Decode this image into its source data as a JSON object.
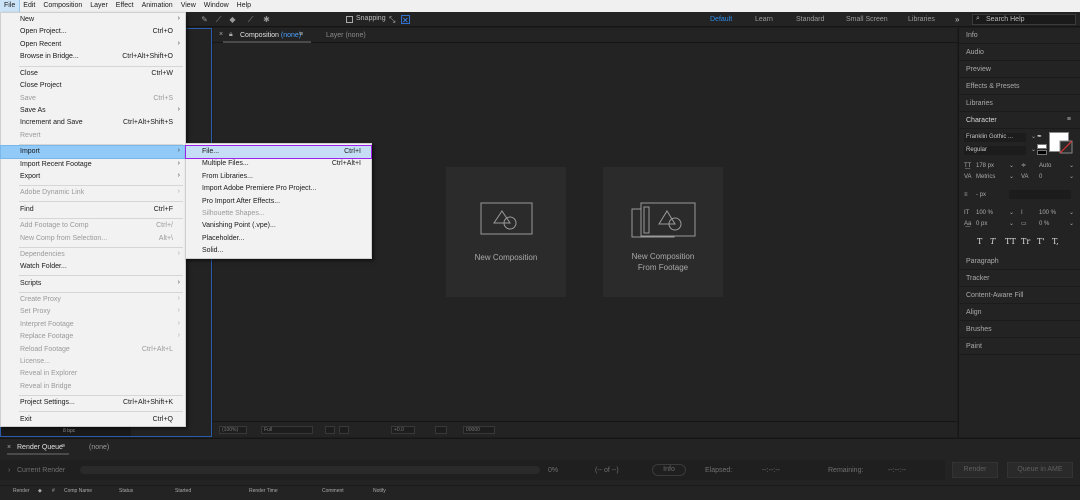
{
  "menubar": [
    "File",
    "Edit",
    "Composition",
    "Layer",
    "Effect",
    "Animation",
    "View",
    "Window",
    "Help"
  ],
  "toolbar": {
    "snapping_label": "Snapping",
    "workspaces": [
      "Default",
      "Learn",
      "Standard",
      "Small Screen",
      "Libraries"
    ],
    "more": "»",
    "search_placeholder": "Search Help"
  },
  "comp_panel": {
    "close": "×",
    "tab_label": "Composition",
    "tab_value": "(none)",
    "tab_menu": "≡",
    "layer_tab": "Layer  (none)",
    "card_new": "New Composition",
    "card_footage_1": "New Composition",
    "card_footage_2": "From Footage",
    "footer_zoom": "(100%)",
    "footer_res": "Full",
    "footer_time": "+0.0",
    "footer_frame": "00000"
  },
  "project_bpc": "8 bpc",
  "right_panels": {
    "top": [
      "Info",
      "Audio",
      "Preview",
      "Effects & Presets",
      "Libraries"
    ],
    "character_title": "Character",
    "character_menu": "≡",
    "font_family": "Franklin Gothic ...",
    "font_style": "Regular",
    "font_size": "178 px",
    "leading": "Auto",
    "kerning": "Metrics",
    "tracking": "0",
    "indent": "- px",
    "vscale": "100 %",
    "hscale": "100 %",
    "baseline": "0 px",
    "tsume": "0 %",
    "styles": [
      "T",
      "T",
      "TT",
      "Tr",
      "T'",
      "T,"
    ],
    "bottom": [
      "Paragraph",
      "Tracker",
      "Content-Aware Fill",
      "Align",
      "Brushes",
      "Paint"
    ]
  },
  "render_queue": {
    "close": "×",
    "tab_label": "Render Queue",
    "tab_menu": "≡",
    "none": "(none)",
    "current_render": "Current Render",
    "percent": "0%",
    "of": "(-- of --)",
    "info": "Info",
    "elapsed": "Elapsed:",
    "elapsed_val": "--:--:--",
    "remaining": "Remaining:",
    "remaining_val": "--:--:--",
    "render_btn": "Render",
    "queue_btn": "Queue in AME",
    "columns": [
      "Render",
      "#",
      "Comp Name",
      "Status",
      "Started",
      "Render Time",
      "Comment",
      "Notify"
    ]
  },
  "file_menu": [
    {
      "label": "New",
      "shortcut": "",
      "arrow": true,
      "disabled": false
    },
    {
      "label": "Open Project...",
      "shortcut": "Ctrl+O",
      "arrow": false,
      "disabled": false
    },
    {
      "label": "Open Recent",
      "shortcut": "",
      "arrow": true,
      "disabled": false
    },
    {
      "label": "Browse in Bridge...",
      "shortcut": "Ctrl+Alt+Shift+O",
      "arrow": false,
      "disabled": false
    },
    {
      "label": "Close",
      "shortcut": "Ctrl+W",
      "arrow": false,
      "disabled": false
    },
    {
      "label": "Close Project",
      "shortcut": "",
      "arrow": false,
      "disabled": false
    },
    {
      "label": "Save",
      "shortcut": "Ctrl+S",
      "arrow": false,
      "disabled": true
    },
    {
      "label": "Save As",
      "shortcut": "",
      "arrow": true,
      "disabled": false
    },
    {
      "label": "Increment and Save",
      "shortcut": "Ctrl+Alt+Shift+S",
      "arrow": false,
      "disabled": false
    },
    {
      "label": "Revert",
      "shortcut": "",
      "arrow": false,
      "disabled": true
    },
    {
      "label": "Import",
      "shortcut": "",
      "arrow": true,
      "disabled": false
    },
    {
      "label": "Import Recent Footage",
      "shortcut": "",
      "arrow": true,
      "disabled": false
    },
    {
      "label": "Export",
      "shortcut": "",
      "arrow": true,
      "disabled": false
    },
    {
      "label": "Adobe Dynamic Link",
      "shortcut": "",
      "arrow": true,
      "disabled": true
    },
    {
      "label": "Find",
      "shortcut": "Ctrl+F",
      "arrow": false,
      "disabled": false
    },
    {
      "label": "Add Footage to Comp",
      "shortcut": "Ctrl+/",
      "arrow": false,
      "disabled": true
    },
    {
      "label": "New Comp from Selection...",
      "shortcut": "Alt+\\",
      "arrow": false,
      "disabled": true
    },
    {
      "label": "Dependencies",
      "shortcut": "",
      "arrow": true,
      "disabled": true
    },
    {
      "label": "Watch Folder...",
      "shortcut": "",
      "arrow": false,
      "disabled": false
    },
    {
      "label": "Scripts",
      "shortcut": "",
      "arrow": true,
      "disabled": false
    },
    {
      "label": "Create Proxy",
      "shortcut": "",
      "arrow": true,
      "disabled": true
    },
    {
      "label": "Set Proxy",
      "shortcut": "",
      "arrow": true,
      "disabled": true
    },
    {
      "label": "Interpret Footage",
      "shortcut": "",
      "arrow": true,
      "disabled": true
    },
    {
      "label": "Replace Footage",
      "shortcut": "",
      "arrow": true,
      "disabled": true
    },
    {
      "label": "Reload Footage",
      "shortcut": "Ctrl+Alt+L",
      "arrow": false,
      "disabled": true
    },
    {
      "label": "License...",
      "shortcut": "",
      "arrow": false,
      "disabled": true
    },
    {
      "label": "Reveal in Explorer",
      "shortcut": "",
      "arrow": false,
      "disabled": true
    },
    {
      "label": "Reveal in Bridge",
      "shortcut": "",
      "arrow": false,
      "disabled": true
    },
    {
      "label": "Project Settings...",
      "shortcut": "Ctrl+Alt+Shift+K",
      "arrow": false,
      "disabled": false
    },
    {
      "label": "Exit",
      "shortcut": "Ctrl+Q",
      "arrow": false,
      "disabled": false
    }
  ],
  "import_menu": [
    {
      "label": "File...",
      "shortcut": "Ctrl+I",
      "disabled": false
    },
    {
      "label": "Multiple Files...",
      "shortcut": "Ctrl+Alt+I",
      "disabled": false
    },
    {
      "label": "From Libraries...",
      "shortcut": "",
      "disabled": false
    },
    {
      "label": "Import Adobe Premiere Pro Project...",
      "shortcut": "",
      "disabled": false
    },
    {
      "label": "Pro Import After Effects...",
      "shortcut": "",
      "disabled": false
    },
    {
      "label": "Silhouette Shapes...",
      "shortcut": "",
      "disabled": true
    },
    {
      "label": "Vanishing Point (.vpe)...",
      "shortcut": "",
      "disabled": false
    },
    {
      "label": "Placeholder...",
      "shortcut": "",
      "disabled": false
    },
    {
      "label": "Solid...",
      "shortcut": "",
      "disabled": false
    }
  ]
}
